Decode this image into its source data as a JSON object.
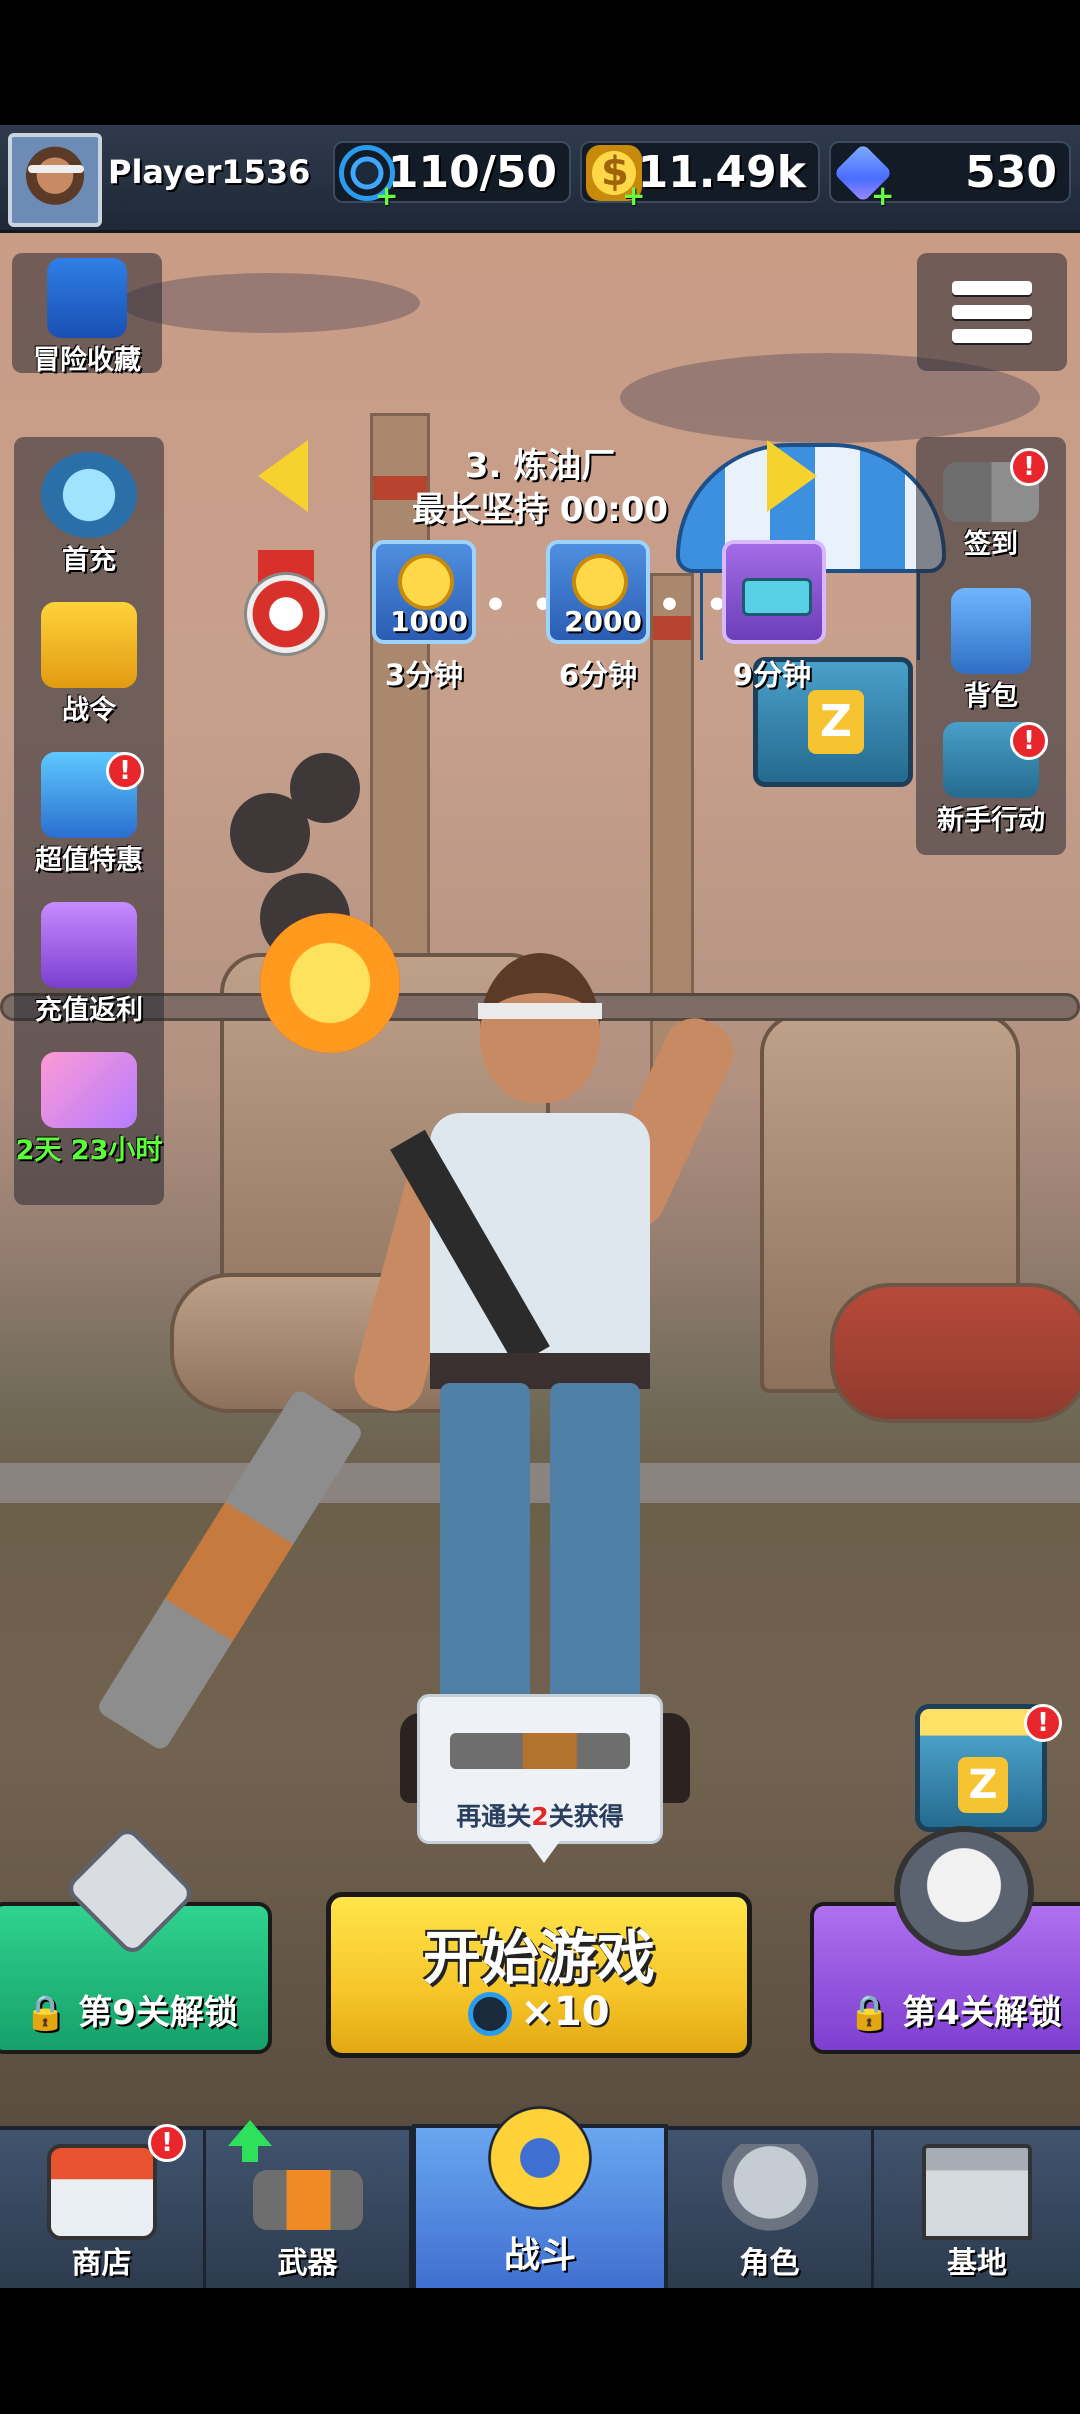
{
  "player": {
    "name": "Player1536"
  },
  "resources": {
    "energy": {
      "icon": "energy-icon",
      "value": "110/50"
    },
    "coins": {
      "icon": "coin-icon",
      "value": "11.49k"
    },
    "gems": {
      "icon": "gem-icon",
      "value": "530"
    },
    "plus": "+"
  },
  "left_menu": {
    "adventure_collection": "冒险收藏",
    "first_recharge": "首充",
    "battle_pass": "战令",
    "super_deal": "超值特惠",
    "recharge_rebate": "充值返利",
    "timer": "2天 23小时"
  },
  "right_menu": {
    "checkin": "签到",
    "backpack": "背包",
    "newbie_action": "新手行动"
  },
  "badge": "!",
  "level": {
    "title": "3. 炼油厂",
    "longest_survival": "最长坚持 00:00",
    "rewards": [
      {
        "amount": "1000",
        "time": "3分钟"
      },
      {
        "amount": "2000",
        "time": "6分钟"
      },
      {
        "amount": "",
        "time": "9分钟"
      }
    ],
    "dots": "• • •"
  },
  "weapon_tooltip": {
    "prefix": "再通关",
    "count": "2",
    "suffix": "关获得"
  },
  "crate_letter": "Z",
  "modes": {
    "left_lock": "第9关解锁",
    "right_lock": "第4关解锁"
  },
  "start_button": {
    "label": "开始游戏",
    "cost": "×10"
  },
  "nav": {
    "shop": "商店",
    "weapons": "武器",
    "battle": "战斗",
    "character": "角色",
    "base": "基地"
  },
  "colors": {
    "accent_yellow": "#f6c62a",
    "mode_green": "#16a06a",
    "mode_purple": "#7d3fcf",
    "badge_red": "#e8262b",
    "nav_active": "#3f6fd0"
  }
}
